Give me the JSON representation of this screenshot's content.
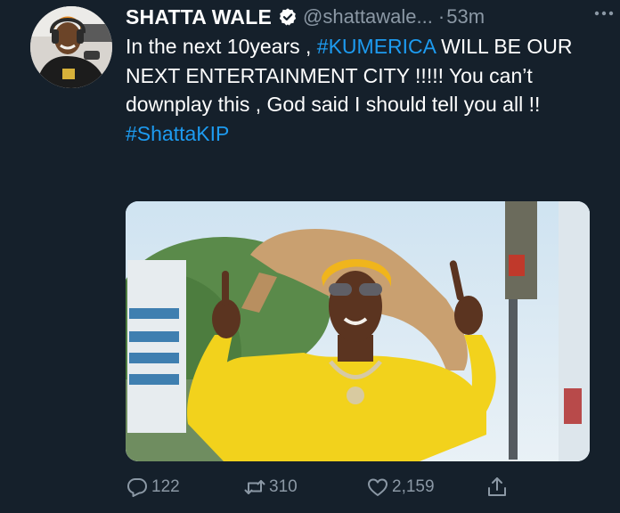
{
  "tweet": {
    "author_name": "SHATTA WALE",
    "handle": "@shattawale...",
    "separator": "·",
    "time": "53m",
    "text_line1_before": "In the next 10years , ",
    "text_hashtag1": "#KUMERICA",
    "text_line1_after": " WILL BE OUR NEXT ENTERTAINMENT CITY !!!!! You can’t downplay this , God said I should tell you all !!",
    "text_hashtag2": "#ShattaKIP"
  },
  "actions": {
    "reply_count": "122",
    "retweet_count": "310",
    "like_count": "2,159"
  },
  "icons": {
    "verified": "verified-badge-icon",
    "more": "more-options-icon",
    "reply": "reply-icon",
    "retweet": "retweet-icon",
    "like": "heart-icon",
    "share": "share-icon"
  },
  "colors": {
    "background": "#15202b",
    "text": "#ffffff",
    "secondary": "#8b98a5",
    "link": "#1d9bf0",
    "media_shirt": "#f2d21c"
  }
}
